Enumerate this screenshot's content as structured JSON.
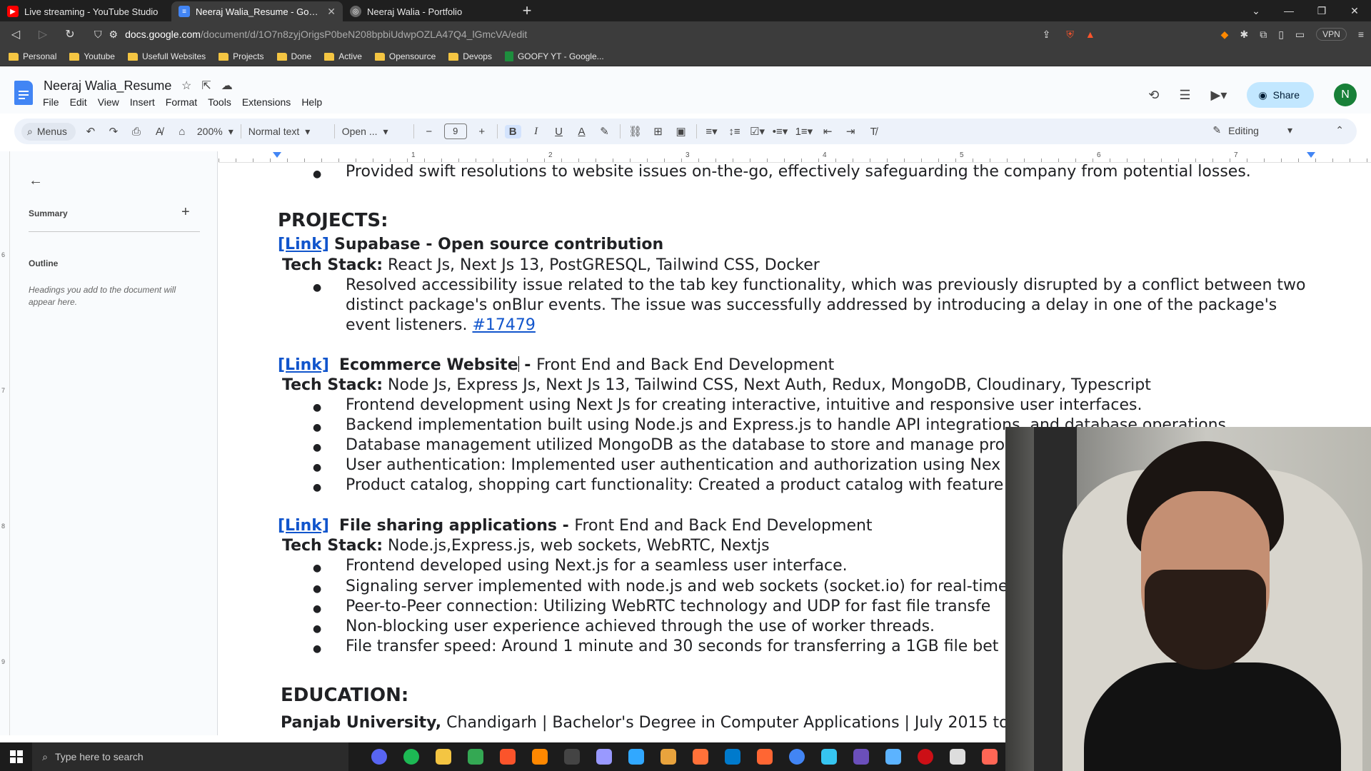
{
  "browser": {
    "tabs": [
      {
        "title": "Live streaming - YouTube Studio",
        "color": "#ff0000"
      },
      {
        "title": "Neeraj Walia_Resume - Google D",
        "color": "#4285f4",
        "active": true
      },
      {
        "title": "Neeraj Walia - Portfolio",
        "color": "#888888"
      }
    ],
    "new_tab": "+",
    "url_domain": "docs.google.com",
    "url_path": "/document/d/1O7n8zyjOrigsP0beN208bpbiUdwpOZLA47Q4_lGmcVA/edit",
    "vpn": "VPN",
    "bookmarks": [
      "Personal",
      "Youtube",
      "Usefull Websites",
      "Projects",
      "Done",
      "Active",
      "Opensource",
      "Devops"
    ],
    "bookmark_sheet": "GOOFY YT - Google..."
  },
  "docs": {
    "title": "Neeraj Walia_Resume",
    "menu": [
      "File",
      "Edit",
      "View",
      "Insert",
      "Format",
      "Tools",
      "Extensions",
      "Help"
    ],
    "share_label": "Share",
    "avatar_letter": "N",
    "toolbar": {
      "search": "Menus",
      "zoom": "200%",
      "style": "Normal text",
      "font": "Open ...",
      "font_size": "9",
      "mode": "Editing"
    }
  },
  "sidebar": {
    "summary_label": "Summary",
    "outline_label": "Outline",
    "outline_hint": "Headings you add to the document will appear here."
  },
  "ruler": {
    "ticks": [
      "1",
      "2",
      "3",
      "4",
      "5",
      "6",
      "7"
    ],
    "vticks": [
      "6",
      "7",
      "8",
      "9"
    ]
  },
  "document": {
    "prev_bullet": "Provided swift resolutions to website issues on-the-go, effectively safeguarding the company from potential losses.",
    "projects_heading": "PROJECTS:",
    "link_label": "[Link]",
    "p1": {
      "title": "Supabase - Open source contribution",
      "stack_label": "Tech Stack:",
      "stack": "React Js, Next Js 13, PostGRESQL, Tailwind CSS, Docker",
      "b1_l1": "Resolved accessibility issue related to the tab key functionality, which was previously disrupted by a conflict between two",
      "b1_l2": "distinct package's onBlur events. The issue was successfully addressed by introducing a delay in one of the package's",
      "b1_l3": "event listeners.",
      "issue": "#17479"
    },
    "p2": {
      "title_a": "Ecommerce Website",
      "title_b": " - ",
      "subtitle": "Front End and Back End Development",
      "stack_label": "Tech Stack:",
      "stack": "Node Js, Express Js, Next Js 13, Tailwind CSS, Next Auth, Redux, MongoDB, Cloudinary, Typescript",
      "bullets": [
        "Frontend development using Next Js for creating interactive, intuitive and responsive user interfaces.",
        "Backend implementation built using Node.js and Express.js to handle API integrations, and database operations.",
        "Database management utilized MongoDB as the database to store and manage pro",
        "User authentication: Implemented user authentication and authorization using Nex",
        "Product catalog, shopping cart functionality: Created a product catalog with feature"
      ]
    },
    "p3": {
      "title": "File sharing applications - ",
      "subtitle": "Front End and Back End Development",
      "stack_label": "Tech Stack:",
      "stack": "Node.js,Express.js, web sockets, WebRTC, Nextjs",
      "bullets": [
        "Frontend developed using Next.js for a seamless user interface.",
        "Signaling server implemented with node.js and web sockets (socket.io) for real-time",
        "Peer-to-Peer connection: Utilizing WebRTC technology and UDP for fast file transfe",
        "Non-blocking user experience achieved through the use of worker threads.",
        "File transfer speed: Around 1 minute and 30 seconds for transferring a 1GB file bet"
      ]
    },
    "education_heading": "EDUCATION:",
    "edu_school": "Panjab University,",
    "edu_rest": " Chandigarh  |  Bachelor's Degree in Computer Applications  |  July 2015 to"
  },
  "taskbar": {
    "search_placeholder": "Type here to search",
    "apps": [
      "#5865f2",
      "#1db954",
      "#f4c542",
      "#34a853",
      "#fb542b",
      "#ff8800",
      "#444444",
      "#9999ff",
      "#31a8ff",
      "#e8a33d",
      "#ff7139",
      "#007acc",
      "#ff6633",
      "#4285f4",
      "#36c5f0",
      "#6b4fbb",
      "#5cb3ff",
      "#cc0f16",
      "#dddddd",
      "#ff6655"
    ]
  }
}
